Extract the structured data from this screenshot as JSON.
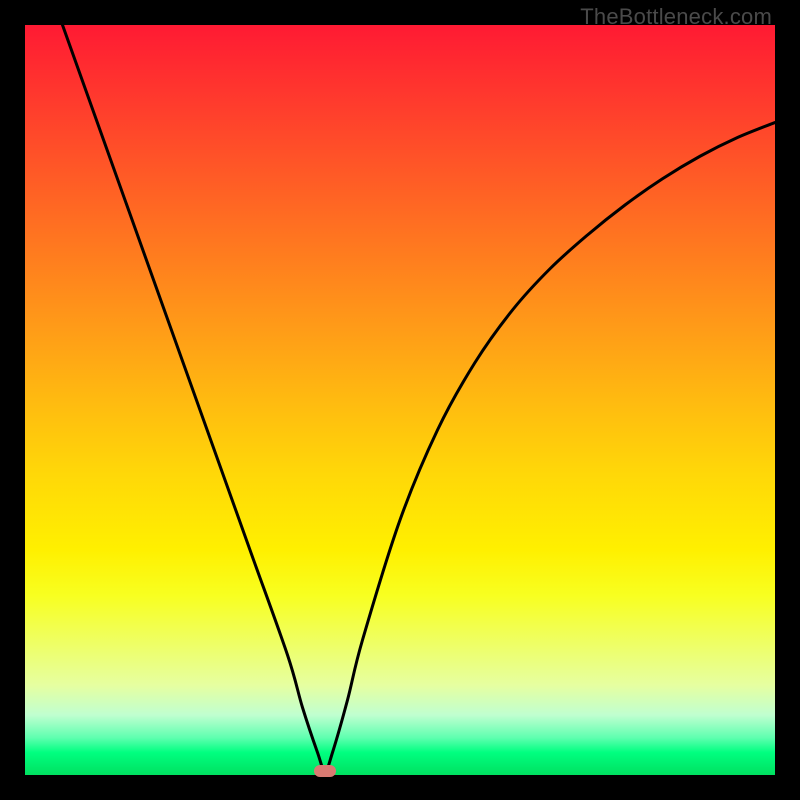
{
  "watermark": "TheBottleneck.com",
  "chart_data": {
    "type": "line",
    "title": "",
    "xlabel": "",
    "ylabel": "",
    "xlim": [
      0,
      100
    ],
    "ylim": [
      0,
      100
    ],
    "grid": false,
    "legend": false,
    "background_gradient": {
      "top": "#ff1a33",
      "mid": "#ffd808",
      "bottom": "#00e060"
    },
    "series": [
      {
        "name": "bottleneck-curve",
        "color": "#000000",
        "x": [
          5,
          10,
          15,
          20,
          25,
          30,
          35,
          37,
          39,
          40,
          41,
          43,
          45,
          50,
          55,
          60,
          65,
          70,
          75,
          80,
          85,
          90,
          95,
          100
        ],
        "y": [
          100,
          86,
          72,
          58,
          44,
          30,
          16,
          9,
          3,
          0.5,
          3,
          10,
          18,
          34,
          46,
          55,
          62,
          67.5,
          72,
          76,
          79.5,
          82.5,
          85,
          87
        ]
      }
    ],
    "markers": [
      {
        "name": "optimal-point",
        "x": 40,
        "y": 0.5,
        "color": "#d87a72"
      }
    ]
  }
}
